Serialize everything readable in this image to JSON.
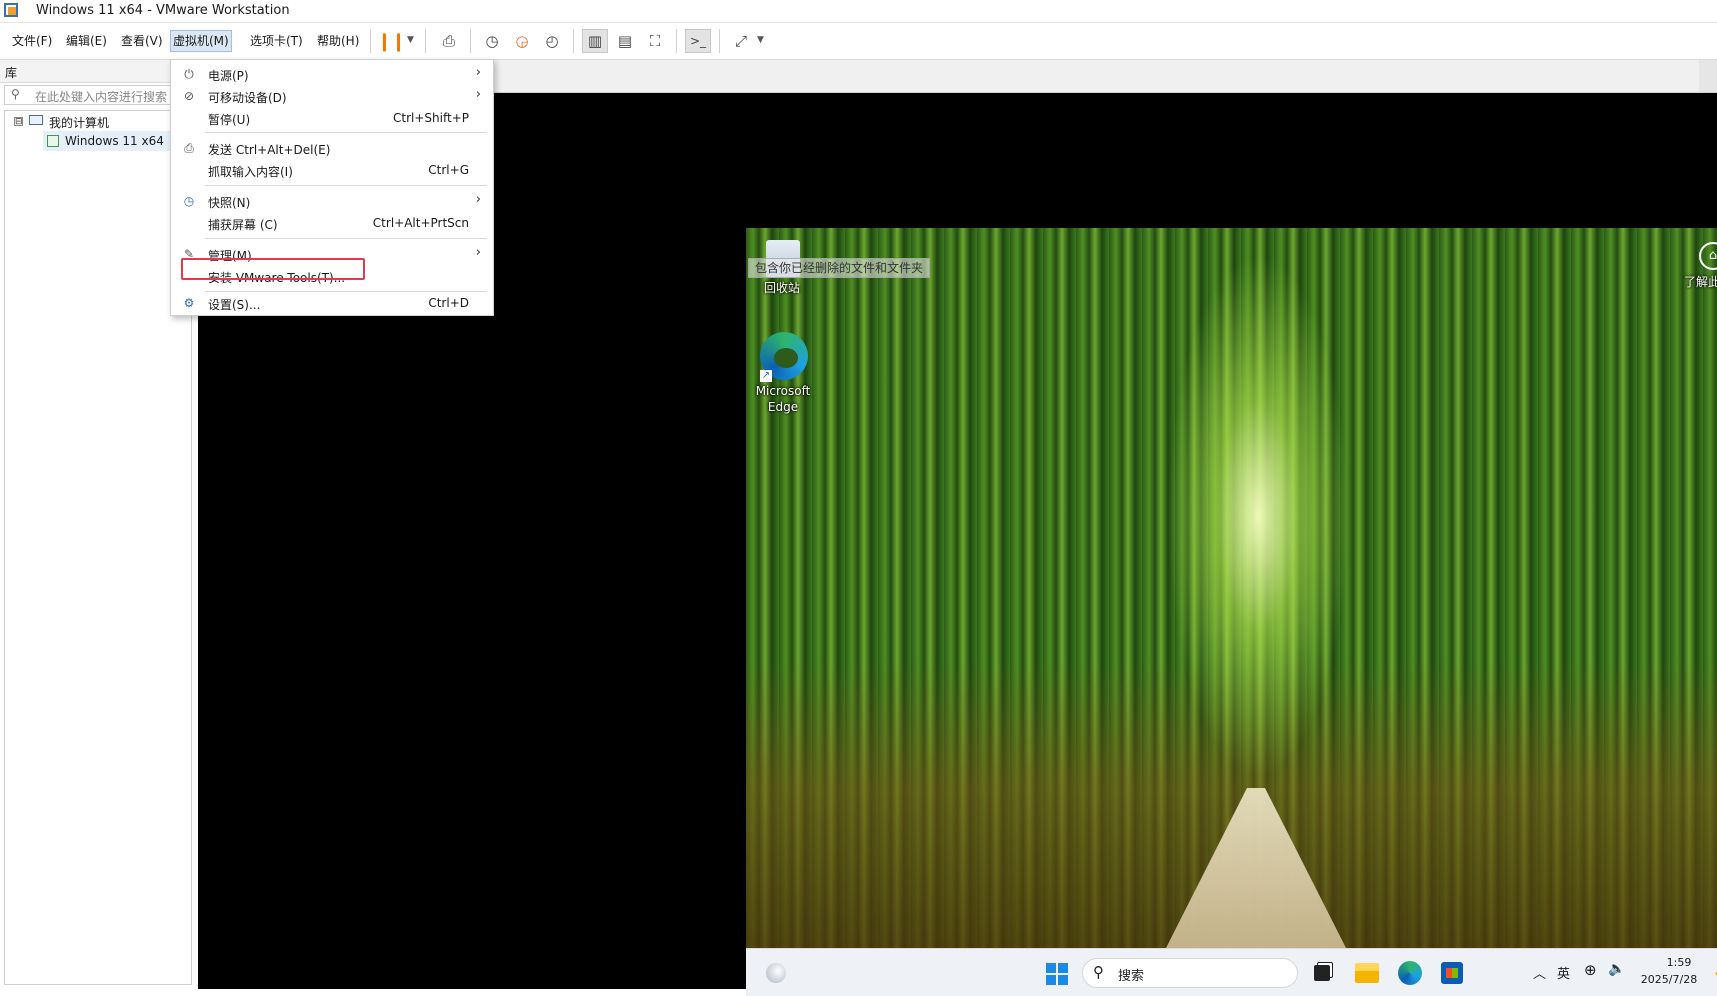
{
  "window": {
    "title": "Windows 11 x64 - VMware Workstation"
  },
  "menubar": {
    "items": [
      "文件(F)",
      "编辑(E)",
      "查看(V)",
      "虚拟机(M)",
      "选项卡(T)",
      "帮助(H)"
    ],
    "active_index": 3
  },
  "toolbar": {
    "icons": [
      "pause-icon",
      "send-ctrl-alt-del-icon",
      "snapshot-take-icon",
      "snapshot-revert-icon",
      "snapshot-manager-icon",
      "library-view-icon",
      "thumbnail-bar-icon",
      "full-screen-icon",
      "console-view-icon",
      "stretch-icon"
    ]
  },
  "library": {
    "title": "库",
    "search_placeholder": "在此处键入内容进行搜索",
    "tree": {
      "root": "我的计算机",
      "expander": "⊟",
      "vm": "Windows 11 x64"
    }
  },
  "vm_menu": {
    "items": [
      {
        "label": "电源(P)",
        "shortcut": "",
        "submenu": true,
        "icon": "power-icon"
      },
      {
        "label": "可移动设备(D)",
        "shortcut": "",
        "submenu": true,
        "icon": "removable-devices-icon"
      },
      {
        "label": "暂停(U)",
        "shortcut": "Ctrl+Shift+P",
        "submenu": false,
        "icon": ""
      },
      {
        "label": "发送 Ctrl+Alt+Del(E)",
        "shortcut": "",
        "submenu": false,
        "icon": "send-keys-icon"
      },
      {
        "label": "抓取输入内容(I)",
        "shortcut": "Ctrl+G",
        "submenu": false,
        "icon": ""
      },
      {
        "label": "快照(N)",
        "shortcut": "",
        "submenu": true,
        "icon": "snapshot-icon"
      },
      {
        "label": "捕获屏幕 (C)",
        "shortcut": "Ctrl+Alt+PrtScn",
        "submenu": false,
        "icon": ""
      },
      {
        "label": "管理(M)",
        "shortcut": "",
        "submenu": true,
        "icon": "wrench-icon"
      },
      {
        "label": "安装 VMware Tools(T)...",
        "shortcut": "",
        "submenu": false,
        "icon": "",
        "highlighted": true
      },
      {
        "label": "设置(S)...",
        "shortcut": "Ctrl+D",
        "submenu": false,
        "icon": "settings-icon"
      }
    ],
    "submenu_arrow": "›",
    "highlight_color": "#e03c4c"
  },
  "guest": {
    "desktop": {
      "recycle_bin_label": "回收站",
      "recycle_bin_tooltip": "包含你已经删除的文件和文件夹",
      "edge_label": "Microsoft Edge",
      "learn_label": "了解此图片"
    },
    "taskbar": {
      "search_label": "搜索",
      "ime": "英",
      "time": "1:59",
      "date": "2025/7/28"
    }
  },
  "colors": {
    "accent": "#f07800",
    "menu_highlight": "#dbe6f3",
    "windows_blue": "#1a8ae6"
  }
}
